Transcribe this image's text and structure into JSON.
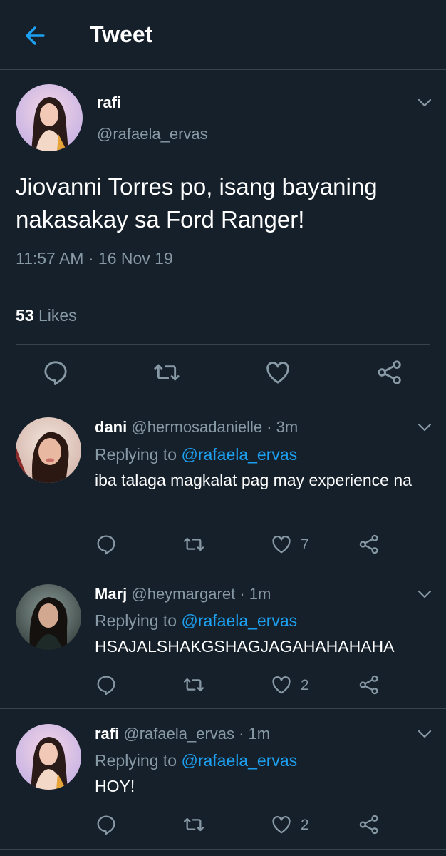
{
  "header": {
    "title": "Tweet",
    "back_icon": "arrow-left-icon"
  },
  "main_tweet": {
    "name": "rafi",
    "handle": "@rafaela_ervas",
    "text": "Jiovanni Torres po, isang bayaning nakasakay sa Ford Ranger!",
    "time": "11:57 AM · 16 Nov 19",
    "likes_count": "53",
    "likes_label": "Likes"
  },
  "replies": [
    {
      "name": "dani",
      "meta": "@hermosadanielle · 3m",
      "replying_prefix": "Replying to",
      "replying_to": "@rafaela_ervas",
      "text": "iba talaga magkalat pag may experience na",
      "like_count": "7"
    },
    {
      "name": "Marj",
      "meta": "@heymargaret · 1m",
      "replying_prefix": "Replying to",
      "replying_to": "@rafaela_ervas",
      "text": "HSAJALSHAKGSHAGJAGAHAHAHAHA",
      "like_count": "2"
    },
    {
      "name": "rafi",
      "meta": "@rafaela_ervas · 1m",
      "replying_prefix": "Replying to",
      "replying_to": "@rafaela_ervas",
      "text": "HOY!",
      "like_count": "2"
    }
  ],
  "colors": {
    "background": "#15202b",
    "accent": "#1da1f2",
    "secondary_text": "#8899a6",
    "divider": "#38444d"
  }
}
